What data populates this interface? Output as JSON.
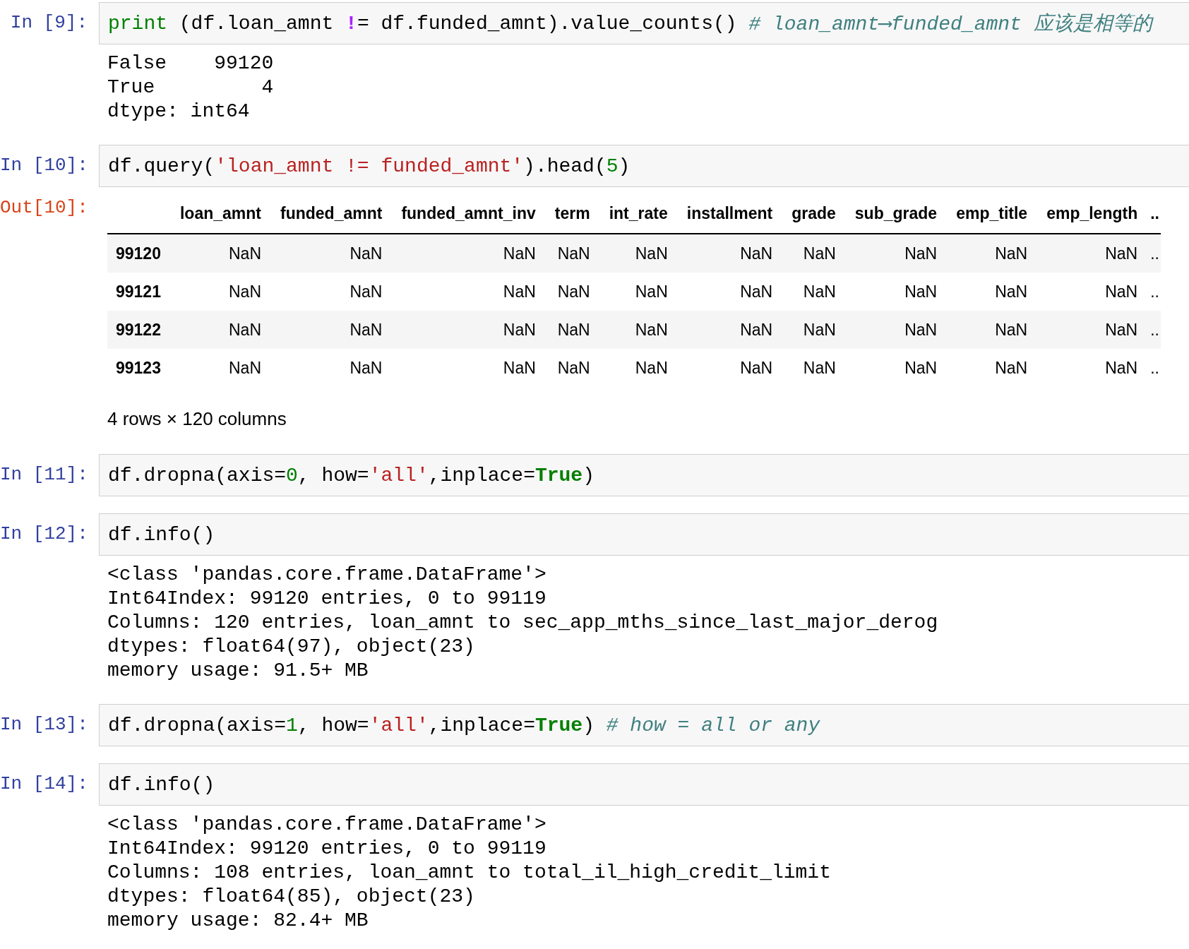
{
  "cells": [
    {
      "prompt": "In [9]:",
      "input": [
        {
          "kind": "builtin",
          "text": "print"
        },
        {
          "kind": "plain",
          "text": " (df.loan_amnt "
        },
        {
          "kind": "op",
          "text": "!"
        },
        {
          "kind": "plain",
          "text": "= df.funded_amnt).value_counts() "
        },
        {
          "kind": "comment",
          "text": "# loan_amnt⟶funded_amnt 应该是相等的"
        }
      ],
      "output": {
        "kind": "text",
        "lines": [
          "False    99120",
          "True         4",
          "dtype: int64"
        ]
      }
    },
    {
      "prompt": "In [10]:",
      "input": [
        {
          "kind": "plain",
          "text": "df.query("
        },
        {
          "kind": "string",
          "text": "'loan_amnt != funded_amnt'"
        },
        {
          "kind": "plain",
          "text": ").head("
        },
        {
          "kind": "number",
          "text": "5"
        },
        {
          "kind": "plain",
          "text": ")"
        }
      ],
      "output": {
        "kind": "table",
        "prompt": "Out[10]:",
        "columns": [
          "loan_amnt",
          "funded_amnt",
          "funded_amnt_inv",
          "term",
          "int_rate",
          "installment",
          "grade",
          "sub_grade",
          "emp_title",
          "emp_length",
          ".."
        ],
        "rows": [
          {
            "index": "99120",
            "cells": [
              "NaN",
              "NaN",
              "NaN",
              "NaN",
              "NaN",
              "NaN",
              "NaN",
              "NaN",
              "NaN",
              "NaN",
              ".."
            ]
          },
          {
            "index": "99121",
            "cells": [
              "NaN",
              "NaN",
              "NaN",
              "NaN",
              "NaN",
              "NaN",
              "NaN",
              "NaN",
              "NaN",
              "NaN",
              ".."
            ]
          },
          {
            "index": "99122",
            "cells": [
              "NaN",
              "NaN",
              "NaN",
              "NaN",
              "NaN",
              "NaN",
              "NaN",
              "NaN",
              "NaN",
              "NaN",
              ".."
            ]
          },
          {
            "index": "99123",
            "cells": [
              "NaN",
              "NaN",
              "NaN",
              "NaN",
              "NaN",
              "NaN",
              "NaN",
              "NaN",
              "NaN",
              "NaN",
              ".."
            ]
          }
        ],
        "caption": "4 rows × 120 columns"
      }
    },
    {
      "prompt": "In [11]:",
      "input": [
        {
          "kind": "plain",
          "text": "df.dropna(axis="
        },
        {
          "kind": "number",
          "text": "0"
        },
        {
          "kind": "plain",
          "text": ", how="
        },
        {
          "kind": "string",
          "text": "'all'"
        },
        {
          "kind": "plain",
          "text": ",inplace="
        },
        {
          "kind": "keyword",
          "text": "True"
        },
        {
          "kind": "plain",
          "text": ")"
        }
      ]
    },
    {
      "prompt": "In [12]:",
      "input": [
        {
          "kind": "plain",
          "text": "df.info()"
        }
      ],
      "output": {
        "kind": "text",
        "lines": [
          "<class 'pandas.core.frame.DataFrame'>",
          "Int64Index: 99120 entries, 0 to 99119",
          "Columns: 120 entries, loan_amnt to sec_app_mths_since_last_major_derog",
          "dtypes: float64(97), object(23)",
          "memory usage: 91.5+ MB"
        ]
      }
    },
    {
      "prompt": "In [13]:",
      "input": [
        {
          "kind": "plain",
          "text": "df.dropna(axis="
        },
        {
          "kind": "number",
          "text": "1"
        },
        {
          "kind": "plain",
          "text": ", how="
        },
        {
          "kind": "string",
          "text": "'all'"
        },
        {
          "kind": "plain",
          "text": ",inplace="
        },
        {
          "kind": "keyword",
          "text": "True"
        },
        {
          "kind": "plain",
          "text": ") "
        },
        {
          "kind": "comment",
          "text": "# how = all or any"
        }
      ]
    },
    {
      "prompt": "In [14]:",
      "input": [
        {
          "kind": "plain",
          "text": "df.info()"
        }
      ],
      "output": {
        "kind": "text",
        "lines": [
          "<class 'pandas.core.frame.DataFrame'>",
          "Int64Index: 99120 entries, 0 to 99119",
          "Columns: 108 entries, loan_amnt to total_il_high_credit_limit",
          "dtypes: float64(85), object(23)",
          "memory usage: 82.4+ MB"
        ]
      }
    }
  ]
}
